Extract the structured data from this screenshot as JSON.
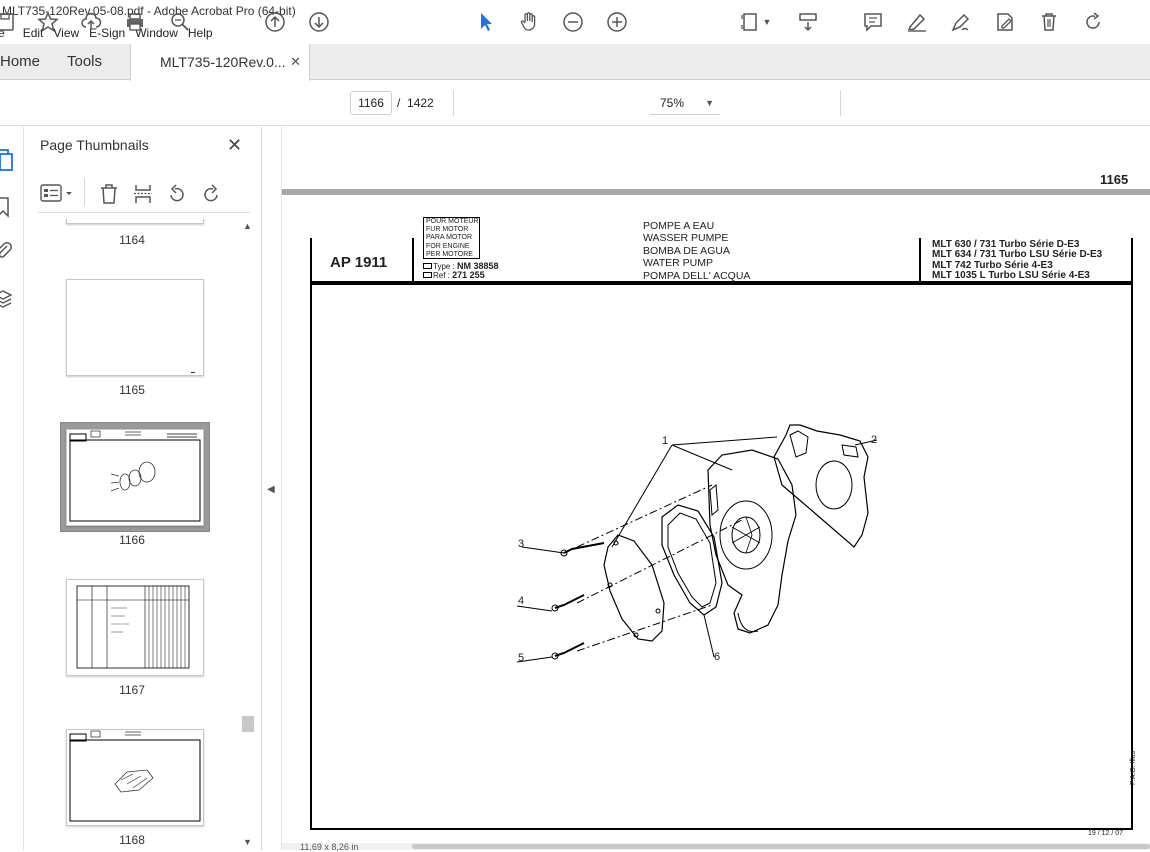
{
  "window": {
    "title": "MLT735-120Rev.05-08.pdf - Adobe Acrobat Pro (64-bit)"
  },
  "menu": {
    "items": [
      "e",
      "Edit",
      "View",
      "E-Sign",
      "Window",
      "Help"
    ]
  },
  "tabs": {
    "home": "Home",
    "tools": "Tools",
    "doc": "MLT735-120Rev.0...",
    "close": "✕"
  },
  "toolbar": {
    "page_current": "1166",
    "page_sep": "/",
    "page_total": "1422",
    "zoom": "75%"
  },
  "sidebar": {
    "title": "Page Thumbnails",
    "thumbs": [
      {
        "label": "1164"
      },
      {
        "label": "1165"
      },
      {
        "label": "1166"
      },
      {
        "label": "1167"
      },
      {
        "label": "1168"
      }
    ]
  },
  "document": {
    "page_number": "1165",
    "ap_code": "AP 1911",
    "motor_lines": [
      "POUR MOTEUR",
      "FUR MOTOR",
      "PARA MOTOR",
      "FOR ENGINE",
      "PER MOTORE"
    ],
    "type_label": "Type : ",
    "type_value": "NM 38858",
    "ref_label": "Ref : ",
    "ref_value": "271 255",
    "part_names": [
      "POMPE A EAU",
      "WASSER PUMPE",
      "BOMBA DE AGUA",
      "WATER PUMP",
      "POMPA DELL' ACQUA"
    ],
    "models": [
      "MLT 630 / 731 Turbo Série D-E3",
      "MLT 634 / 731 Turbo LSU Série D-E3",
      "MLT 742 Turbo Série 4-E3",
      "MLT 1035 L Turbo LSU Série 4-E3"
    ],
    "callouts": [
      "1",
      "2",
      "3",
      "4",
      "5",
      "6"
    ],
    "side_label": "P.A.O. Illus",
    "date": "19 / 12 / 07"
  },
  "status": {
    "dimensions": "11,69 x 8,26 in"
  }
}
